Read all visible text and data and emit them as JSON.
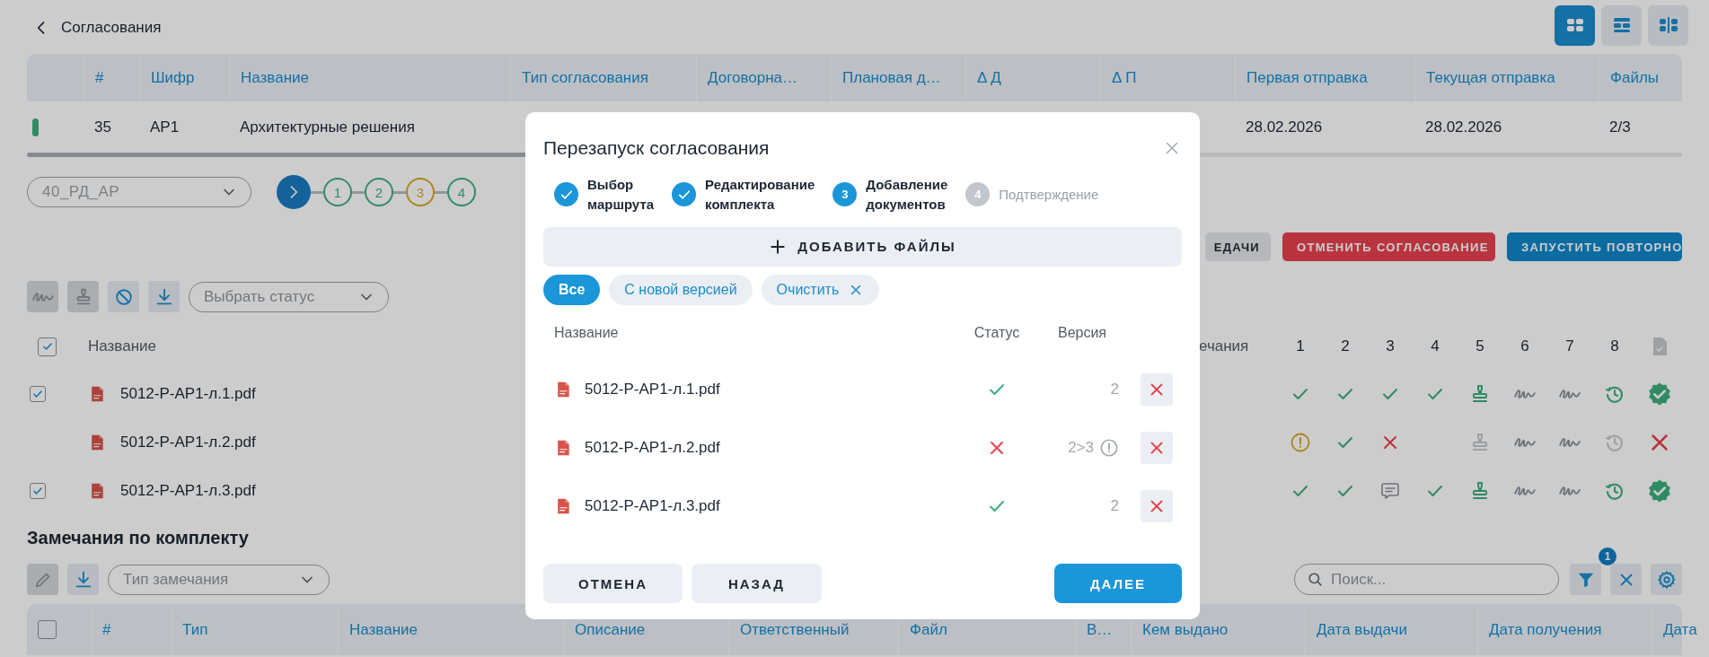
{
  "header": {
    "title": "Согласования"
  },
  "view_modes": [
    {
      "kind": "grid",
      "selected": true
    },
    {
      "kind": "rows",
      "selected": false
    },
    {
      "kind": "split",
      "selected": false
    }
  ],
  "approvals_table": {
    "columns": [
      "#",
      "Шифр",
      "Название",
      "Тип согласования",
      "Договорна…",
      "Плановая д…",
      "Δ Д",
      "Δ П",
      "Первая отправка",
      "Текущая отправка",
      "Файлы"
    ],
    "rows": [
      {
        "color": "#318b65",
        "number": "35",
        "code": "АР1",
        "name": "Архитектурные решения",
        "first_sent": "28.02.2026",
        "current_sent": "28.02.2026",
        "files": "2/3"
      }
    ]
  },
  "set_selector": {
    "value": "40_РД_АР"
  },
  "stage_steps": [
    {
      "label": "1",
      "color": "#318b65"
    },
    {
      "label": "2",
      "color": "#318b65"
    },
    {
      "label": "3",
      "color": "#ae841a"
    },
    {
      "label": "4",
      "color": "#318b65"
    }
  ],
  "actions": [
    {
      "label": "ЕДАЧИ",
      "kind": "neutral"
    },
    {
      "label": "ОТМЕНИТЬ СОГЛАСОВАНИЕ",
      "kind": "danger"
    },
    {
      "label": "ЗАПУСТИТЬ ПОВТОРНО",
      "kind": "primary"
    }
  ],
  "files_toolbar": {
    "tools": [
      {
        "kind": "sign",
        "disabled": true
      },
      {
        "kind": "stamp",
        "disabled": true
      },
      {
        "kind": "ban",
        "disabled": false
      },
      {
        "kind": "download",
        "disabled": false
      }
    ],
    "status_select": {
      "placeholder": "Выбрать статус"
    }
  },
  "files_table": {
    "header_checked": true,
    "name_column": "Название",
    "remarks_column": "ечания",
    "approver_columns": [
      "1",
      "2",
      "3",
      "4",
      "5",
      "6",
      "7",
      "8"
    ],
    "rows": [
      {
        "checked": true,
        "name": "5012-Р-АР1-л.1.pdf",
        "marks": [
          {
            "kind": "check"
          },
          {
            "kind": "check"
          },
          {
            "kind": "check"
          },
          {
            "kind": "check"
          },
          {
            "kind": "stamp",
            "active": true
          },
          {
            "kind": "sign"
          },
          {
            "kind": "sign"
          },
          {
            "kind": "clock",
            "active": true
          }
        ],
        "approved": true
      },
      {
        "name": "5012-Р-АР1-л.2.pdf",
        "marks": [
          {
            "kind": "warning"
          },
          {
            "kind": "check"
          },
          {
            "kind": "cross"
          },
          {
            "kind": "empty"
          },
          {
            "kind": "stamp",
            "active": false
          },
          {
            "kind": "sign"
          },
          {
            "kind": "sign"
          },
          {
            "kind": "clock",
            "active": false
          }
        ],
        "approved": false
      },
      {
        "checked": true,
        "name": "5012-Р-АР1-л.3.pdf",
        "marks": [
          {
            "kind": "check"
          },
          {
            "kind": "check"
          },
          {
            "kind": "comment"
          },
          {
            "kind": "check"
          },
          {
            "kind": "stamp",
            "active": true
          },
          {
            "kind": "sign"
          },
          {
            "kind": "sign"
          },
          {
            "kind": "clock",
            "active": true
          }
        ],
        "approved": true
      }
    ]
  },
  "remarks_section": {
    "title": "Замечания по комплекту",
    "tools": [
      {
        "kind": "edit",
        "disabled": true
      },
      {
        "kind": "download",
        "disabled": false
      }
    ],
    "type_select": {
      "placeholder": "Тип замечания"
    },
    "search": {
      "placeholder": "Поиск..."
    },
    "filter_count": "1",
    "header_checked": false,
    "columns": [
      "#",
      "Тип",
      "Название",
      "Описание",
      "Ответственный",
      "Файл",
      "В…",
      "Кем выдано",
      "Дата выдачи",
      "Дата получения",
      "Дата"
    ]
  },
  "modal": {
    "title": "Перезапуск согласования",
    "steps": [
      {
        "label": "Выбор маршрута",
        "done": true,
        "selected": false
      },
      {
        "label": "Редактирование комплекта",
        "done": true,
        "selected": false
      },
      {
        "number": "3",
        "label": "Добавление документов",
        "done": false,
        "selected": true
      },
      {
        "number": "4",
        "label": "Подтверждение",
        "done": false,
        "selected": false
      }
    ],
    "add_files": "ДОБАВИТЬ ФАЙЛЫ",
    "filters": [
      {
        "label": "Все",
        "selected": true
      },
      {
        "label": "С новой версией",
        "selected": false
      }
    ],
    "clear_filter": "Очистить",
    "columns": {
      "name": "Название",
      "status": "Статус",
      "version": "Версия"
    },
    "files": [
      {
        "name": "5012-Р-АР1-л.1.pdf",
        "valid": true,
        "version": "2",
        "version_warning": false
      },
      {
        "name": "5012-Р-АР1-л.2.pdf",
        "valid": false,
        "version": "2>3",
        "version_warning": true
      },
      {
        "name": "5012-Р-АР1-л.3.pdf",
        "valid": true,
        "version": "2",
        "version_warning": false
      }
    ],
    "buttons": [
      {
        "label": "ОТМЕНА",
        "kind": "secondary"
      },
      {
        "label": "НАЗАД",
        "kind": "secondary"
      },
      {
        "label": "ДАЛЕЕ",
        "kind": "primary"
      }
    ]
  }
}
